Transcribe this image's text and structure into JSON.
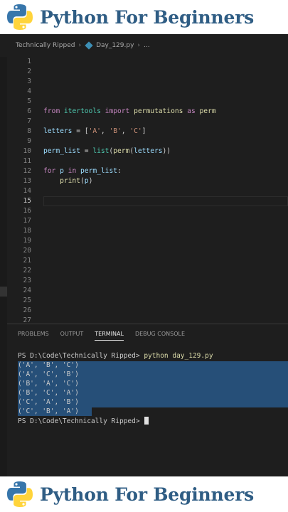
{
  "banner": {
    "title": "Python For Beginners"
  },
  "editor": {
    "breadcrumb": {
      "folder": "Technically Ripped",
      "file": "Day_129.py",
      "more": "..."
    },
    "line_numbers": [
      "1",
      "2",
      "3",
      "4",
      "5",
      "6",
      "7",
      "8",
      "9",
      "10",
      "11",
      "12",
      "13",
      "14",
      "15",
      "16",
      "17",
      "18",
      "19",
      "20",
      "21",
      "22",
      "23",
      "24",
      "25",
      "26",
      "27"
    ],
    "active_line": "15",
    "code": {
      "l6_from": "from",
      "l6_module": "itertools",
      "l6_import": "import",
      "l6_name": "permutations",
      "l6_as": "as",
      "l6_alias": "perm",
      "l8_var": "letters",
      "l8_eq": " = [",
      "l8_a": "'A'",
      "l8_c1": ", ",
      "l8_b": "'B'",
      "l8_c2": ", ",
      "l8_c": "'C'",
      "l8_end": "]",
      "l10_var": "perm_list",
      "l10_eq": " = ",
      "l10_fn1": "list",
      "l10_p1": "(",
      "l10_fn2": "perm",
      "l10_p2": "(",
      "l10_arg": "letters",
      "l10_end": "))",
      "l12_for": "for",
      "l12_p": "p",
      "l12_in": "in",
      "l12_list": "perm_list",
      "l12_colon": ":",
      "l13_indent": "    ",
      "l13_fn": "print",
      "l13_open": "(",
      "l13_arg": "p",
      "l13_close": ")"
    }
  },
  "panel": {
    "tabs": [
      "PROBLEMS",
      "OUTPUT",
      "TERMINAL",
      "DEBUG CONSOLE"
    ],
    "active_tab": "TERMINAL",
    "terminal": {
      "prompt": "PS D:\\Code\\Technically Ripped>",
      "command": "python day_129.py",
      "output": [
        "('A', 'B', 'C')",
        "('A', 'C', 'B')",
        "('B', 'A', 'C')",
        "('B', 'C', 'A')",
        "('C', 'A', 'B')",
        "('C', 'B', 'A')"
      ],
      "final_prompt": "PS D:\\Code\\Technically Ripped>"
    }
  }
}
